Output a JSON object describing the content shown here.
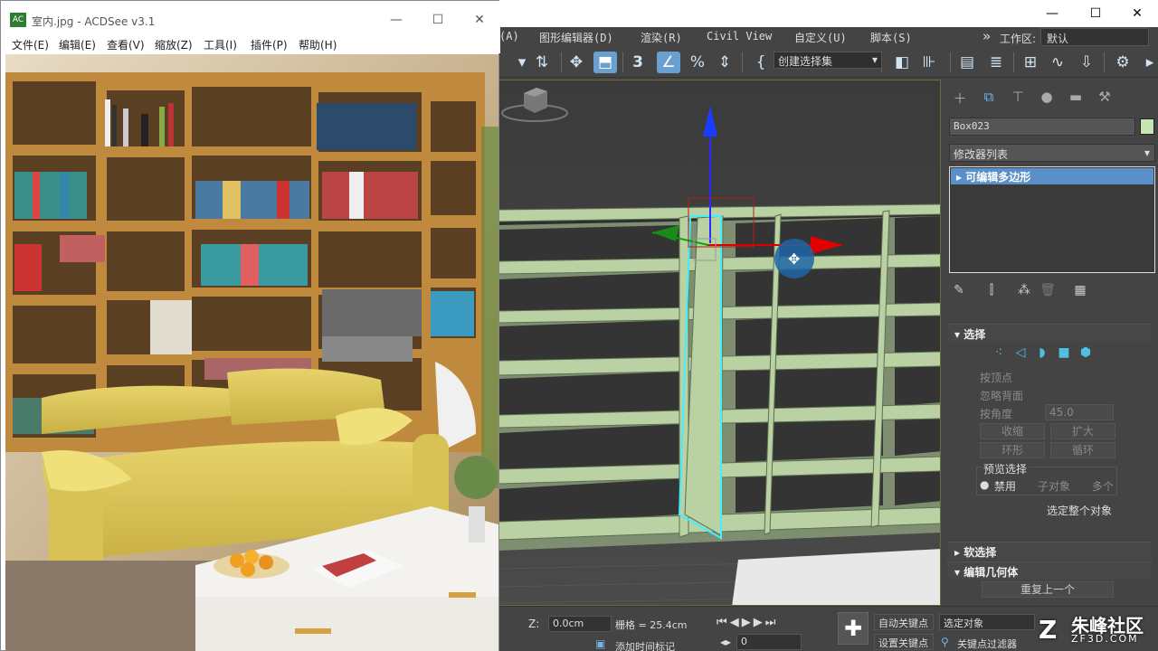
{
  "max": {
    "window_buttons": [
      "—",
      "☐",
      "✕"
    ],
    "menu": [
      "(A)",
      "图形编辑器(D)",
      "渲染(R)",
      "Civil View",
      "自定义(U)",
      "脚本(S)"
    ],
    "menu_more": "»",
    "workspace_label": "工作区:",
    "workspace_value": "默认",
    "selection_set_placeholder": "创建选择集",
    "toolbar_icons": [
      "snap-toggle-icon",
      "move-icon",
      "select-region-icon",
      "snap-3-icon",
      "angle-snap-icon",
      "percent-snap-icon",
      "spinner-snap-icon",
      "edit-named-selection-icon",
      "mirror-icon",
      "align-icon",
      "layer-manager-icon",
      "scene-explorer-icon",
      "ribbon-icon",
      "curve-editor-icon",
      "schematic-view-icon",
      "material-editor-icon"
    ],
    "object_name": "Box023",
    "object_color": "#c8e6b4",
    "modifier_list": "修改器列表",
    "modifier_stack_item": "可编辑多边形",
    "selection_rollout": {
      "title": "选择",
      "by_vertex": "按顶点",
      "ignore_backfacing": "忽略背面",
      "by_angle": "按角度",
      "angle_value": "45.0",
      "shrink": "收缩",
      "grow": "扩大",
      "ring": "环形",
      "loop": "循环",
      "preview_selection": "预览选择",
      "disabled": "禁用",
      "subobject": "子对象",
      "multi": "多个",
      "whole_object": "选定整个对象"
    },
    "soft_selection": "软选择",
    "edit_geometry": "编辑几何体",
    "repeat_last": "重复上一个",
    "statusbar": {
      "z_label": "Z:",
      "z_value": "0.0cm",
      "grid_label": "栅格 = 25.4cm",
      "add_time_tag": "添加时间标记",
      "auto_key": "自动关键点",
      "set_key": "设置关键点",
      "selected_object": "选定对象",
      "key_filters": "关键点过滤器",
      "frame_value": "0"
    },
    "accent": "#5a8fc8"
  },
  "acdsee": {
    "title": "室内.jpg - ACDSee v3.1",
    "logo": "AC",
    "window_buttons": [
      "—",
      "☐",
      "✕"
    ],
    "menu": [
      "文件(E)",
      "编辑(E)",
      "查看(V)",
      "缩放(Z)",
      "工具(I)",
      "插件(P)",
      "帮助(H)"
    ]
  },
  "watermark": {
    "text": "朱峰社区",
    "sub": "ZF3D.COM"
  }
}
